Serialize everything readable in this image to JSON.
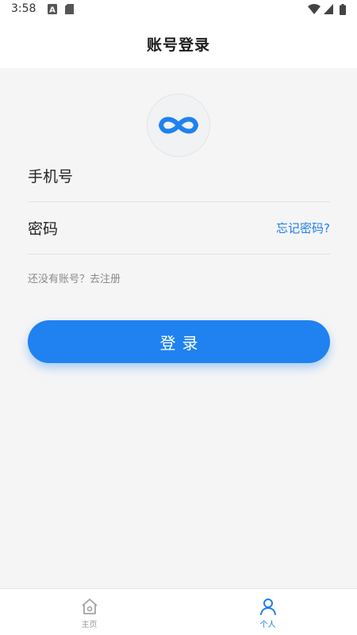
{
  "status_bar": {
    "time": "3:58",
    "icons": [
      "notification-a-icon",
      "sd-card-icon",
      "wifi-icon",
      "cell-signal-icon",
      "battery-icon"
    ]
  },
  "header": {
    "title": "账号登录"
  },
  "form": {
    "phone_label": "手机号",
    "password_label": "密码",
    "forgot_link": "忘记密码?",
    "register_text": "还没有账号？去注册"
  },
  "login_button": {
    "label": "登录"
  },
  "tabbar": {
    "items": [
      {
        "label": "主页",
        "icon": "home-icon",
        "active": false
      },
      {
        "label": "个人",
        "icon": "user-icon",
        "active": true
      }
    ]
  },
  "colors": {
    "accent": "#1f82f0",
    "link": "#1e7ee8",
    "background": "#f5f5f6"
  }
}
